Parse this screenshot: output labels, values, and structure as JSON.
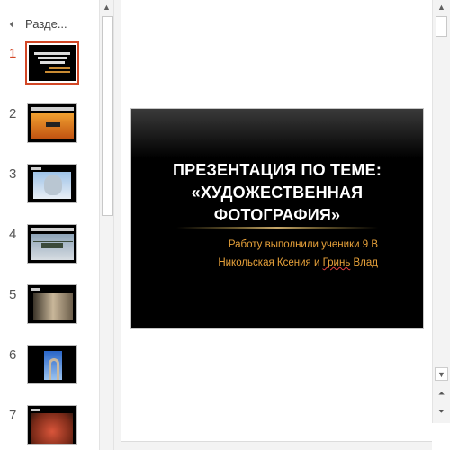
{
  "thumbnails_pane": {
    "section_label": "Разде...",
    "slides": [
      {
        "number": "1",
        "active": true,
        "theme": "title-dark"
      },
      {
        "number": "2",
        "active": false,
        "theme": "orange-sunset-helicopter"
      },
      {
        "number": "3",
        "active": false,
        "theme": "sky-photo"
      },
      {
        "number": "4",
        "active": false,
        "theme": "helicopter-photo"
      },
      {
        "number": "5",
        "active": false,
        "theme": "sepia-portrait"
      },
      {
        "number": "6",
        "active": false,
        "theme": "arch-photo"
      },
      {
        "number": "7",
        "active": false,
        "theme": "red-texture"
      }
    ]
  },
  "slide": {
    "title_line1": "ПРЕЗЕНТАЦИЯ ПО ТЕМЕ:",
    "title_line2": "«ХУДОЖЕСТВЕННАЯ",
    "title_line3": "ФОТОГРАФИЯ»",
    "subtitle_line1": "Работу выполнили ученики 9 В",
    "subtitle_line2_prefix": "Никольская Ксения и ",
    "subtitle_line2_misspelled": "Гринь",
    "subtitle_line2_suffix": " Влад"
  },
  "colors": {
    "active_accent": "#d24726",
    "subtitle_text": "#e8a23a"
  }
}
